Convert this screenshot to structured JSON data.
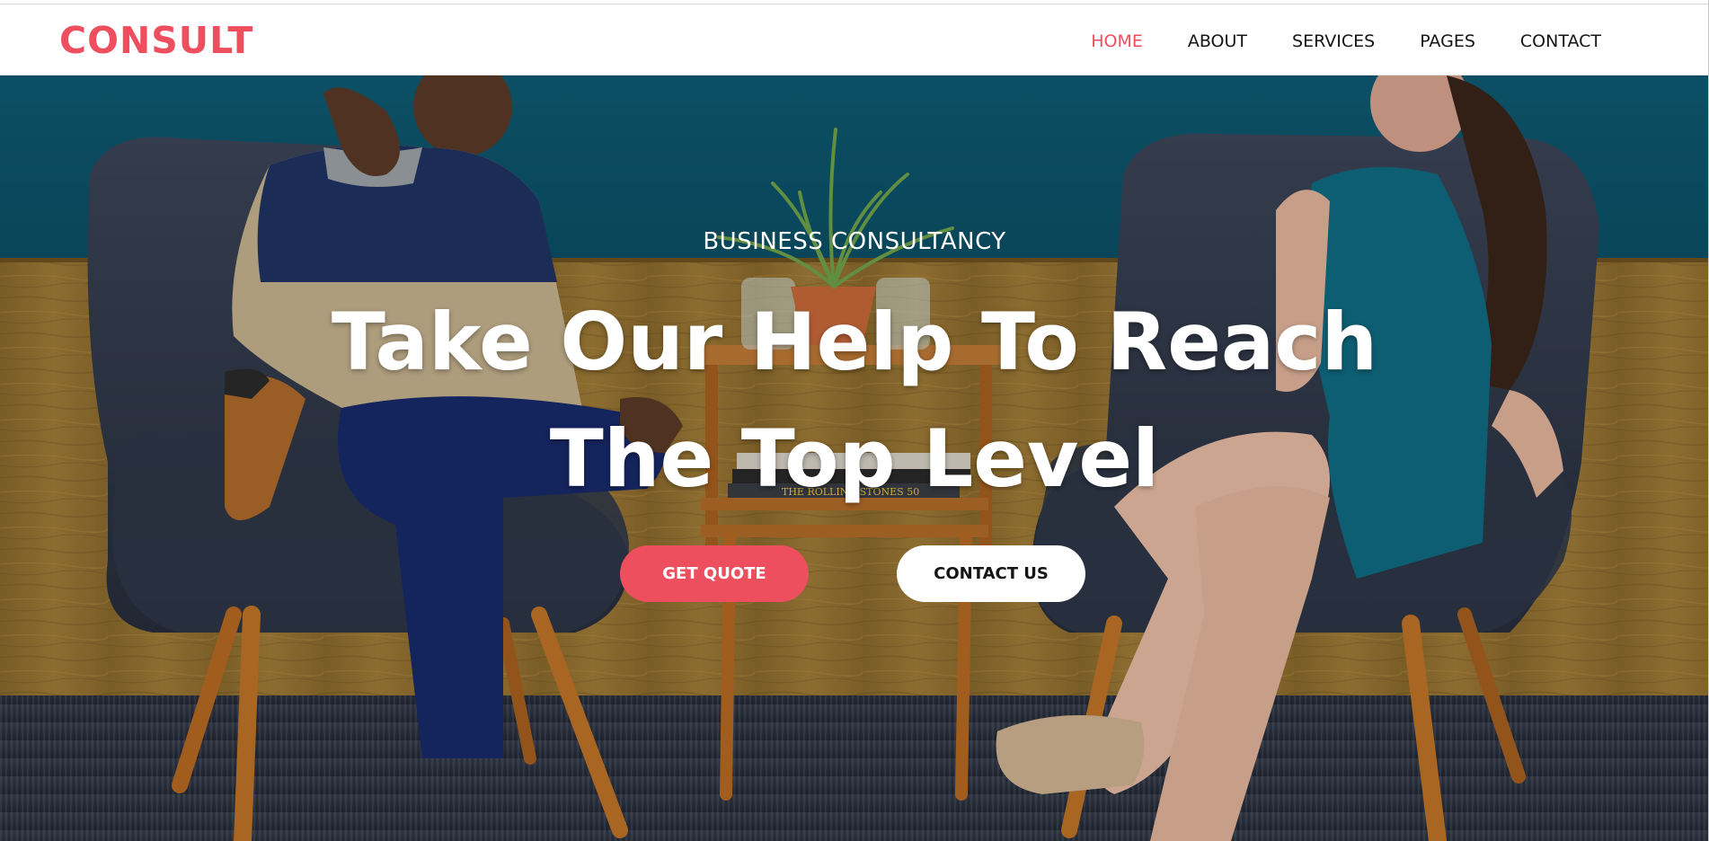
{
  "brand": {
    "logo": "CONSULT",
    "accent_color": "#ee4f5e"
  },
  "nav": {
    "items": [
      {
        "label": "HOME",
        "active": true
      },
      {
        "label": "ABOUT",
        "active": false
      },
      {
        "label": "SERVICES",
        "active": false
      },
      {
        "label": "PAGES",
        "active": false
      },
      {
        "label": "CONTACT",
        "active": false
      }
    ]
  },
  "hero": {
    "eyebrow": "BUSINESS CONSULTANCY",
    "headline_line1": "Take Our Help To Reach",
    "headline_line2": "The Top Level",
    "primary_button": "GET QUOTE",
    "secondary_button": "CONTACT US",
    "book_spine_text": "THE ROLLING STONES 50"
  }
}
